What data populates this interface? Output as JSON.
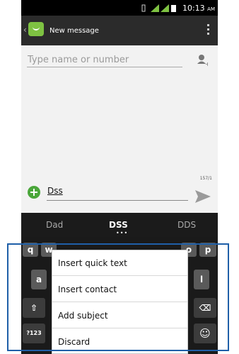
{
  "status_bar": {
    "time": "10:13",
    "ampm": "AM"
  },
  "action_bar": {
    "title": "New message"
  },
  "compose": {
    "recipient_placeholder": "Type name or number"
  },
  "message": {
    "counter": "157/1",
    "text": "Dss"
  },
  "suggestions": [
    "Dad",
    "DSS",
    "DDS"
  ],
  "keyboard": {
    "keys": {
      "q": "q",
      "w": "w",
      "p1": "o",
      "p2": "p",
      "a": "a",
      "l": "l",
      "shift": "⇧",
      "backspace": "⌫",
      "sym": "?123",
      "smiley": "☺"
    }
  },
  "popup_menu": {
    "items": [
      "Insert quick text",
      "Insert contact",
      "Add subject",
      "Discard"
    ]
  },
  "colors": {
    "accent_green": "#7ec242",
    "highlight_blue": "#1f5fa8"
  }
}
